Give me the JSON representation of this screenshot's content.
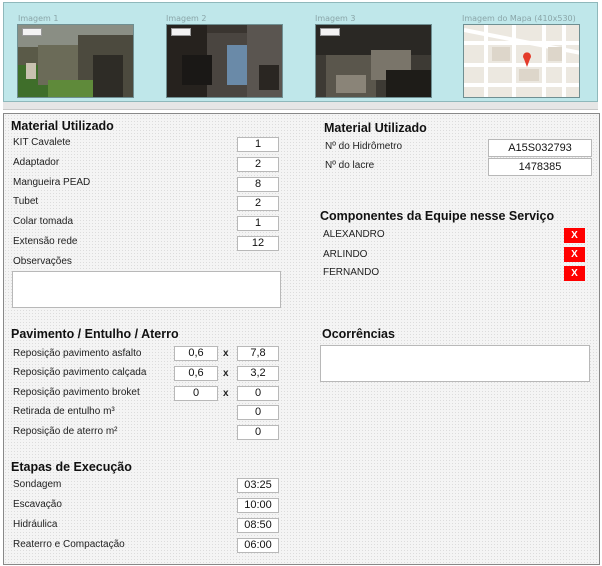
{
  "images": {
    "img1_label": "Imagem 1",
    "img2_label": "Imagem 2",
    "img3_label": "Imagem 3",
    "map_label": "Imagem do Mapa (410x530)"
  },
  "material": {
    "title": "Material Utilizado",
    "items": [
      {
        "label": "KIT Cavalete",
        "value": "1"
      },
      {
        "label": "Adaptador",
        "value": "2"
      },
      {
        "label": "Mangueira PEAD",
        "value": "8"
      },
      {
        "label": "Tubet",
        "value": "2"
      },
      {
        "label": "Colar tomada",
        "value": "1"
      },
      {
        "label": "Extensão rede",
        "value": "12"
      }
    ],
    "obs_label": "Observações"
  },
  "material_right": {
    "title": "Material Utilizado",
    "hidrometro_label": "Nº do Hidrômetro",
    "hidrometro_value": "A15S032793",
    "lacre_label": "Nº do lacre",
    "lacre_value": "1478385"
  },
  "equipe": {
    "title": "Componentes da Equipe nesse Serviço",
    "members": [
      "ALEXANDRO",
      "ARLINDO",
      "FERNANDO"
    ],
    "remove_label": "X"
  },
  "pavimento": {
    "title": "Pavimento / Entulho / Aterro",
    "multiply": "x",
    "rows": [
      {
        "label": "Reposição pavimento asfalto",
        "a": "0,6",
        "b": "7,8"
      },
      {
        "label": "Reposição pavimento calçada",
        "a": "0,6",
        "b": "3,2"
      },
      {
        "label": "Reposição pavimento broket",
        "a": "0",
        "b": "0"
      }
    ],
    "entulho_label": "Retirada de entulho m³",
    "entulho_value": "0",
    "aterro_label": "Reposição de aterro m²",
    "aterro_value": "0"
  },
  "ocorrencias": {
    "title": "Ocorrências"
  },
  "etapas": {
    "title": "Etapas de Execução",
    "items": [
      {
        "label": "Sondagem",
        "value": "03:25"
      },
      {
        "label": "Escavação",
        "value": "10:00"
      },
      {
        "label": "Hidráulica",
        "value": "08:50"
      },
      {
        "label": "Reaterro e Compactação",
        "value": "06:00"
      }
    ]
  }
}
